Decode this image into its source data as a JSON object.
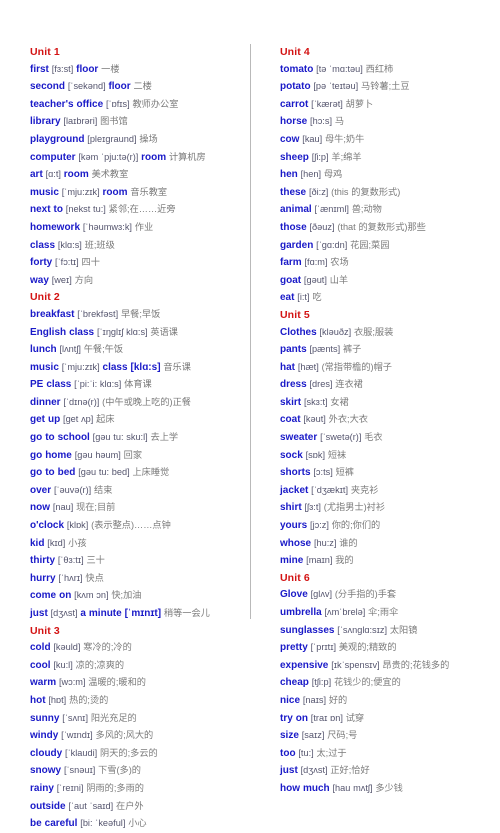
{
  "document": {
    "type": "vocabulary-list",
    "colors": {
      "unit_heading": "#d31313",
      "word": "#1a1ac8",
      "phonetic": "#55556e",
      "translation": "#7a7a7a",
      "divider": "#b9b9b9",
      "background": "#ffffff"
    }
  },
  "columns": [
    {
      "id": "left",
      "blocks": [
        {
          "unit": "Unit 1",
          "entries": [
            {
              "word": "first",
              "phonetic": "[fɜ:st]",
              "extra": "floor",
              "cn": "一楼"
            },
            {
              "word": "second",
              "phonetic": "[ˈsekənd]",
              "extra": "floor",
              "cn": "二楼"
            },
            {
              "word": "teacher's office",
              "phonetic": "[ˈɒfɪs]",
              "extra": "",
              "cn": "教师办公室"
            },
            {
              "word": "library",
              "phonetic": "[laɪbrəri]",
              "extra": "",
              "cn": "图书馆"
            },
            {
              "word": "playground",
              "phonetic": "[pleɪgraund]",
              "extra": "",
              "cn": "操场"
            },
            {
              "word": "computer",
              "phonetic": "[kəm ˈpju:tə(r)]",
              "extra": "room",
              "cn": "计算机房"
            },
            {
              "word": "art",
              "phonetic": "[ɑ:t]",
              "extra": "room",
              "cn": "美术教室"
            },
            {
              "word": "music",
              "phonetic": "[ˈmju:zɪk]",
              "extra": "room",
              "cn": "音乐教室"
            },
            {
              "word": "next to",
              "phonetic": "[nekst tu:]",
              "extra": "",
              "cn": "紧邻;在……近旁"
            },
            {
              "word": "homework",
              "phonetic": "[ˈhəumwɜ:k]",
              "extra": "",
              "cn": "作业"
            },
            {
              "word": "class",
              "phonetic": "[klɑ:s]",
              "extra": "",
              "cn": "班;班级"
            },
            {
              "word": "forty",
              "phonetic": "[ˈfɔ:tɪ]",
              "extra": "",
              "cn": "四十"
            },
            {
              "word": "way",
              "phonetic": "[weɪ]",
              "extra": "",
              "cn": "方向"
            }
          ]
        },
        {
          "unit": "Unit 2",
          "entries": [
            {
              "word": "breakfast",
              "phonetic": "[ˈbrekfəst]",
              "extra": "",
              "cn": "早餐;早饭"
            },
            {
              "word": "English   class",
              "phonetic": "[ˈɪŋglɪʃ   klɑ:s]",
              "extra": "",
              "cn": "英语课"
            },
            {
              "word": "lunch",
              "phonetic": "[lʌntʃ]",
              "extra": "",
              "cn": "午餐;午饭"
            },
            {
              "word": "music",
              "phonetic": "[ˈmju:zɪk]",
              "extra": "class   [klɑ:s]",
              "cn": "音乐课"
            },
            {
              "word": "PE class",
              "phonetic": "[ˈpi:ˈi: klɑ:s]",
              "extra": "",
              "cn": "体育课"
            },
            {
              "word": "dinner",
              "phonetic": "[ˈdɪnə(r)]",
              "extra": "",
              "cn": "(中午或晚上吃的)正餐"
            },
            {
              "word": "get up",
              "phonetic": "[get ʌp]",
              "extra": "",
              "cn": "起床"
            },
            {
              "word": "go to school",
              "phonetic": "[gəu tu: sku:l]",
              "extra": "",
              "cn": "去上学"
            },
            {
              "word": "go home",
              "phonetic": "[gəu həum]",
              "extra": "",
              "cn": "回家"
            },
            {
              "word": "go to bed",
              "phonetic": "[gəu tu: bed]",
              "extra": "",
              "cn": "上床睡觉"
            },
            {
              "word": "over",
              "phonetic": "[ˈəuvə(r)]",
              "extra": "",
              "cn": "结束"
            },
            {
              "word": "now",
              "phonetic": "[nau]",
              "extra": "",
              "cn": "现在;目前"
            },
            {
              "word": "o'clock",
              "phonetic": "[klɒk]",
              "extra": "",
              "cn": "(表示整点)……点钟"
            },
            {
              "word": "kid",
              "phonetic": "[kɪd]",
              "extra": "",
              "cn": "小孩"
            },
            {
              "word": "thirty",
              "phonetic": "[ˈθɜ:tɪ]",
              "extra": "",
              "cn": "三十"
            },
            {
              "word": "hurry",
              "phonetic": "[ˈhʌrɪ]",
              "extra": "",
              "cn": "快点"
            },
            {
              "word": "come on",
              "phonetic": "[kʌm ɔn]",
              "extra": "",
              "cn": "快;加油"
            },
            {
              "word": "just",
              "phonetic": "[dʒʌst]",
              "extra": "a minute [ˈmɪnɪt]",
              "cn": "稍等一会儿"
            }
          ]
        },
        {
          "unit": "Unit 3",
          "entries": [
            {
              "word": "cold",
              "phonetic": "[kəuld]",
              "extra": "",
              "cn": "寒冷的;冷的"
            },
            {
              "word": "cool",
              "phonetic": "[ku:l]",
              "extra": "",
              "cn": "凉的;凉爽的"
            },
            {
              "word": "warm",
              "phonetic": "[wɔ:m]",
              "extra": "",
              "cn": "温暖的;暖和的"
            },
            {
              "word": "hot",
              "phonetic": "[hɒt]",
              "extra": "",
              "cn": "热的;烫的"
            },
            {
              "word": "sunny",
              "phonetic": "[ˈsʌnɪ]",
              "extra": "",
              "cn": "阳光充足的"
            },
            {
              "word": "windy",
              "phonetic": "[ˈwɪndɪ]",
              "extra": "",
              "cn": "多风的;风大的"
            },
            {
              "word": "cloudy",
              "phonetic": "[ˈklaudi]",
              "extra": "",
              "cn": "阴天的;多云的"
            },
            {
              "word": "snowy",
              "phonetic": "[ˈsnəuɪ]",
              "extra": "",
              "cn": "下雪(多)的"
            },
            {
              "word": "rainy",
              "phonetic": "[ˈreɪni]",
              "extra": "",
              "cn": "阴雨的;多雨的"
            },
            {
              "word": "outside",
              "phonetic": "[ˈaut ˈsaɪd]",
              "extra": "",
              "cn": "在户外"
            },
            {
              "word": "be careful",
              "phonetic": "[bi: ˈkeəful]",
              "extra": "",
              "cn": "小心"
            }
          ]
        }
      ]
    },
    {
      "id": "right",
      "blocks": [
        {
          "unit": "Unit 4",
          "entries": [
            {
              "word": "tomato",
              "phonetic": "[tə ˈmɑ:təu]",
              "extra": "",
              "cn": "西红柿"
            },
            {
              "word": "potato",
              "phonetic": "[pə ˈteɪtəu]",
              "extra": "",
              "cn": "马铃薯;土豆"
            },
            {
              "word": "carrot",
              "phonetic": "[ˈkærət]",
              "extra": "",
              "cn": "胡萝卜"
            },
            {
              "word": "horse",
              "phonetic": "[hɔ:s]",
              "extra": "",
              "cn": "马"
            },
            {
              "word": "cow",
              "phonetic": "[kau]",
              "extra": "",
              "cn": "母牛;奶牛"
            },
            {
              "word": "sheep",
              "phonetic": "[ʃi:p]",
              "extra": "",
              "cn": "羊;绵羊"
            },
            {
              "word": "hen",
              "phonetic": "[hen]",
              "extra": "",
              "cn": "母鸡"
            },
            {
              "word": "these",
              "phonetic": "[ði:z]",
              "extra": "",
              "cn": "(this 的复数形式)"
            },
            {
              "word": "animal",
              "phonetic": "[ˈænɪml]",
              "extra": "",
              "cn": "兽;动物"
            },
            {
              "word": "those",
              "phonetic": "[ðəuz]",
              "extra": "",
              "cn": "(that 的复数形式)那些"
            },
            {
              "word": "garden",
              "phonetic": "[ˈgɑ:dn]",
              "extra": "",
              "cn": "花园;菜园"
            },
            {
              "word": "farm",
              "phonetic": "[fɑ:m]",
              "extra": "",
              "cn": "农场"
            },
            {
              "word": "goat",
              "phonetic": "[gəut]",
              "extra": "",
              "cn": "山羊"
            },
            {
              "word": "eat",
              "phonetic": "[i:t]",
              "extra": "",
              "cn": "吃"
            }
          ]
        },
        {
          "unit": "Unit 5",
          "entries": [
            {
              "word": "Clothes",
              "phonetic": "[kləuðz]",
              "extra": "",
              "cn": "衣服;服装"
            },
            {
              "word": "pants",
              "phonetic": "[pænts]",
              "extra": "",
              "cn": "裤子"
            },
            {
              "word": "hat",
              "phonetic": "[hæt]",
              "extra": "",
              "cn": "(常指带檐的)帽子"
            },
            {
              "word": "dress",
              "phonetic": "[dres]",
              "extra": "",
              "cn": "连衣裙"
            },
            {
              "word": "skirt",
              "phonetic": "[skɜ:t]",
              "extra": "",
              "cn": "女裙"
            },
            {
              "word": "coat",
              "phonetic": "[kəut]",
              "extra": "",
              "cn": "外衣;大衣"
            },
            {
              "word": "sweater",
              "phonetic": "[ˈswetə(r)]",
              "extra": "",
              "cn": "毛衣"
            },
            {
              "word": "sock",
              "phonetic": "[sɒk]",
              "extra": "",
              "cn": "短袜"
            },
            {
              "word": "shorts",
              "phonetic": "[ɔ:ts]",
              "extra": "",
              "cn": "短裤"
            },
            {
              "word": "jacket",
              "phonetic": "[ˈdʒækɪt]",
              "extra": "",
              "cn": "夹克衫"
            },
            {
              "word": "shirt",
              "phonetic": "[ʃɜ:t]",
              "extra": "",
              "cn": "(尤指男士)衬衫"
            },
            {
              "word": "yours",
              "phonetic": "[jɔ:z]",
              "extra": "",
              "cn": "你的;你们的"
            },
            {
              "word": "whose",
              "phonetic": "[hu:z]",
              "extra": "",
              "cn": "谁的"
            },
            {
              "word": "mine",
              "phonetic": "[maɪn]",
              "extra": "",
              "cn": "我的"
            }
          ]
        },
        {
          "unit": "Unit 6",
          "entries": [
            {
              "word": "Glove",
              "phonetic": "[glʌv]",
              "extra": "",
              "cn": "(分手指的)手套"
            },
            {
              "word": "umbrella",
              "phonetic": "[ʌmˈbrelə]",
              "extra": "",
              "cn": "伞;雨伞"
            },
            {
              "word": "sunglasses",
              "phonetic": "[ˈsʌnglɑ:sɪz]",
              "extra": "",
              "cn": "太阳镜"
            },
            {
              "word": "pretty",
              "phonetic": "[ˈprɪtɪ]",
              "extra": "",
              "cn": "美观的;精致的"
            },
            {
              "word": "expensive",
              "phonetic": "[ɪkˈspensɪv]",
              "extra": "",
              "cn": "昂贵的;花钱多的"
            },
            {
              "word": "cheap",
              "phonetic": "[tʃi:p]",
              "extra": "",
              "cn": "花钱少的;便宜的"
            },
            {
              "word": "nice",
              "phonetic": "[naɪs]",
              "extra": "",
              "cn": "好的"
            },
            {
              "word": "try on",
              "phonetic": "[traɪ ɒn]",
              "extra": "",
              "cn": "试穿"
            },
            {
              "word": "size",
              "phonetic": "[saɪz]",
              "extra": "",
              "cn": "尺码;号"
            },
            {
              "word": "too",
              "phonetic": "[tu:]",
              "extra": "",
              "cn": "太;过于"
            },
            {
              "word": "just",
              "phonetic": "[dʒʌst]",
              "extra": "",
              "cn": "正好;恰好"
            },
            {
              "word": "how much",
              "phonetic": "[hau mʌtʃ]",
              "extra": "",
              "cn": "多少钱"
            }
          ]
        }
      ]
    }
  ]
}
